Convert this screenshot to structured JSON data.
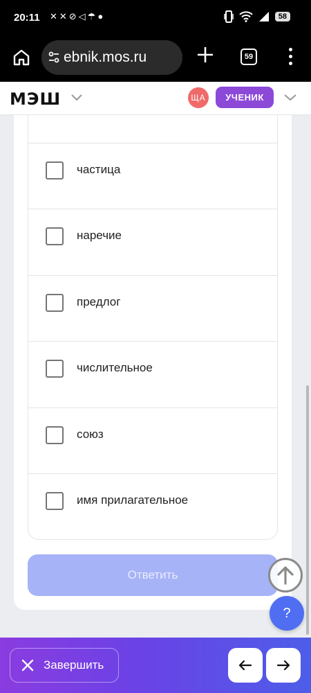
{
  "status_bar": {
    "time": "20:11",
    "notification_icons": "✕✕⊘◁☂●",
    "battery": "58"
  },
  "browser": {
    "url": "ebnik.mos.ru",
    "tab_count": "59"
  },
  "header": {
    "logo": "МЭШ",
    "avatar_initials": "ЩА",
    "role": "УЧЕНИК",
    "brand_color": "#8c49d8"
  },
  "options": [
    {
      "label": "частица",
      "checked": false
    },
    {
      "label": "наречие",
      "checked": false
    },
    {
      "label": "предлог",
      "checked": false
    },
    {
      "label": "числительное",
      "checked": false
    },
    {
      "label": "союз",
      "checked": false
    },
    {
      "label": "имя прилагательное",
      "checked": false
    }
  ],
  "answer_button": {
    "label": "Ответить",
    "enabled": false
  },
  "help_button": {
    "label": "?"
  },
  "bottom_bar": {
    "finish_label": "Завершить"
  }
}
